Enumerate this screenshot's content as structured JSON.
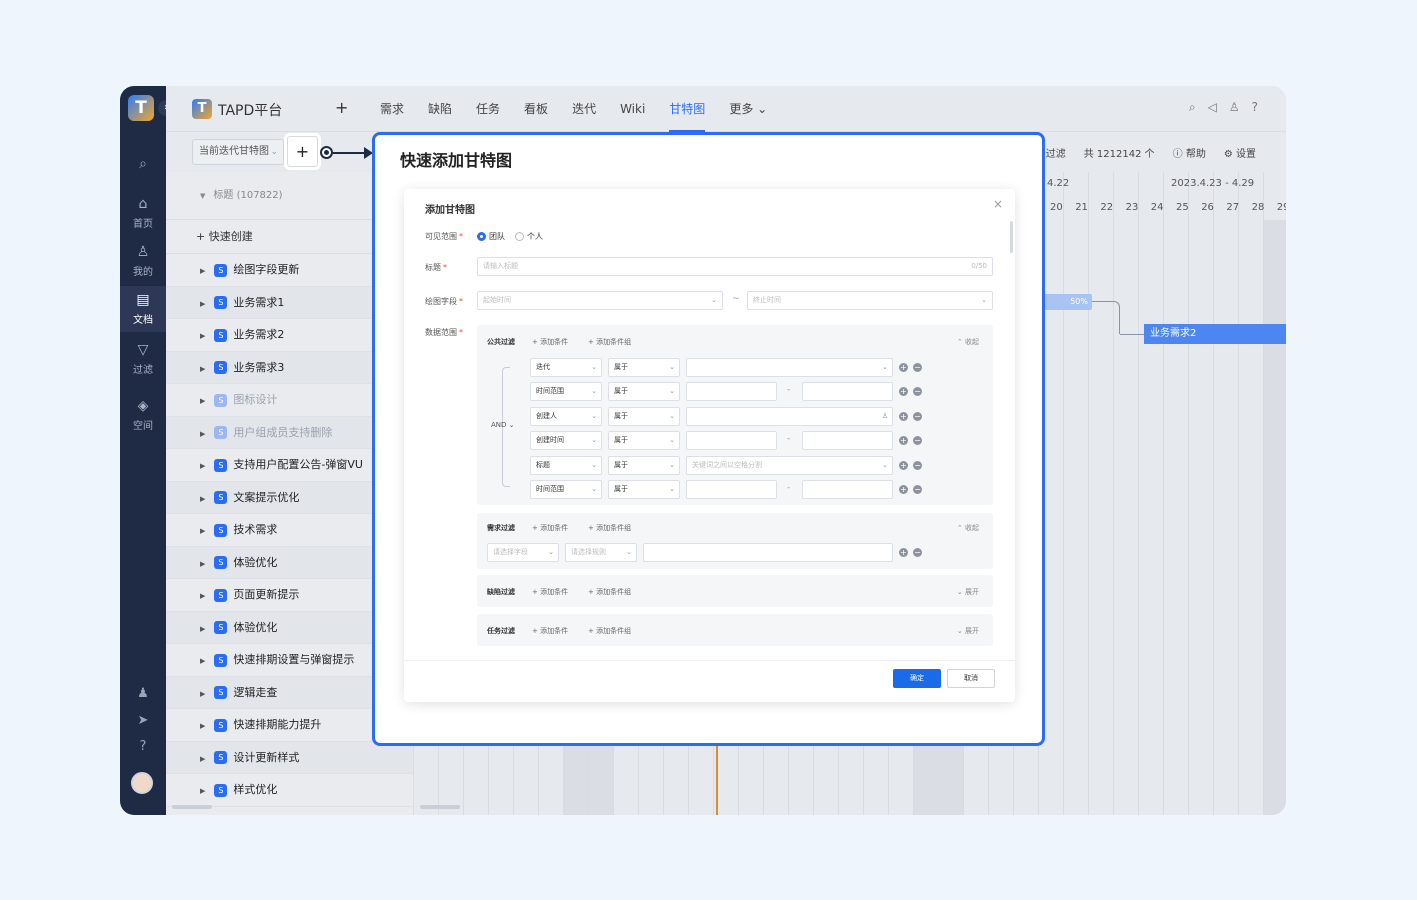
{
  "rail": {
    "items": [
      {
        "label": "首页"
      },
      {
        "label": "我的"
      },
      {
        "label": "文档"
      },
      {
        "label": "过滤"
      },
      {
        "label": "空间"
      }
    ]
  },
  "header": {
    "brand": "TAPD平台",
    "tabs": [
      "需求",
      "缺陷",
      "任务",
      "看板",
      "迭代",
      "Wiki",
      "甘特图",
      "更多"
    ],
    "active_tab": "甘特图"
  },
  "toolbar": {
    "view_select": "当前迭代甘特图",
    "add": "+",
    "filter": "过滤",
    "total": "共 1212142 个",
    "help": "帮助",
    "settings": "设置"
  },
  "list": {
    "header": "标题 (107822)",
    "quick_create": "快速创建",
    "rows": [
      {
        "title": "绘图字段更新",
        "dim": false
      },
      {
        "title": "业务需求1",
        "dim": false
      },
      {
        "title": "业务需求2",
        "dim": false
      },
      {
        "title": "业务需求3",
        "dim": false
      },
      {
        "title": "图标设计",
        "dim": true
      },
      {
        "title": "用户组成员支持删除",
        "dim": true
      },
      {
        "title": "支持用户配置公告-弹窗VU",
        "dim": false
      },
      {
        "title": "文案提示优化",
        "dim": false
      },
      {
        "title": "技术需求",
        "dim": false
      },
      {
        "title": "体验优化",
        "dim": false
      },
      {
        "title": "页面更新提示",
        "dim": false
      },
      {
        "title": "体验优化",
        "dim": false
      },
      {
        "title": "快速排期设置与弹窗提示",
        "dim": false
      },
      {
        "title": "逻辑走查",
        "dim": false
      },
      {
        "title": "快速排期能力提升",
        "dim": false
      },
      {
        "title": "设计更新样式",
        "dim": false
      },
      {
        "title": "样式优化",
        "dim": false
      }
    ]
  },
  "gantt": {
    "weeks": [
      "4.22",
      "2023.4.23 - 4.29"
    ],
    "days": [
      "20",
      "21",
      "22",
      "23",
      "24",
      "25",
      "26",
      "27",
      "28",
      "29"
    ],
    "bar_progress_label": "50%",
    "bar_label": "业务需求2"
  },
  "callout": {
    "title": "快速添加甘特图"
  },
  "dialog": {
    "title": "添加甘特图",
    "close": "×",
    "visibility": {
      "label": "可见范围",
      "options": [
        "团队",
        "个人"
      ],
      "selected": "团队"
    },
    "title_field": {
      "label": "标题",
      "placeholder": "请输入标题",
      "counter": "0/50"
    },
    "draw_field": {
      "label": "绘图字段",
      "start_placeholder": "起始时间",
      "end_placeholder": "终止时间",
      "separator": "~"
    },
    "data_range": {
      "label": "数据范围"
    },
    "add_condition": "添加条件",
    "add_condition_group": "添加条件组",
    "collapse": "收起",
    "expand": "展开",
    "logic": "AND",
    "public_filter": {
      "title": "公共过滤",
      "conditions": [
        {
          "field": "迭代",
          "op": "属于",
          "kind": "select",
          "value": ""
        },
        {
          "field": "时间范围",
          "op": "属于",
          "kind": "range",
          "value": ""
        },
        {
          "field": "创建人",
          "op": "属于",
          "kind": "user",
          "value": ""
        },
        {
          "field": "创建时间",
          "op": "属于",
          "kind": "range",
          "value": ""
        },
        {
          "field": "标题",
          "op": "属于",
          "kind": "select",
          "value": "关键词之间以空格分割"
        },
        {
          "field": "时间范围",
          "op": "属于",
          "kind": "range",
          "value": ""
        }
      ]
    },
    "story_filter": {
      "title": "需求过滤",
      "field_placeholder": "请选择字段",
      "rule_placeholder": "请选择规则"
    },
    "bug_filter": {
      "title": "缺陷过滤"
    },
    "task_filter": {
      "title": "任务过滤"
    },
    "ok": "确定",
    "cancel": "取消"
  }
}
